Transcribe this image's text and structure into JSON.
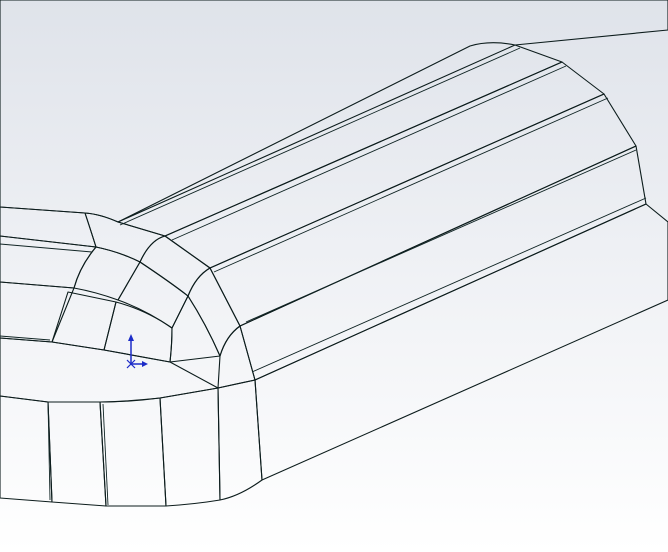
{
  "viewport": {
    "background_top": "#dfe3ea",
    "background_bottom": "#ffffff"
  },
  "model": {
    "kind": "filleted-box-corner",
    "top_face_color": "#79f0ee",
    "fillet_light_color": "#6fe2e0",
    "fillet_mid_color": "#5fc2c0",
    "side_face_color": "#3c7c78",
    "front_face_color": "#7fe7e8",
    "highlight_color": "#ffffff",
    "edge_color": "#0c1c1c"
  },
  "triad": {
    "icon": "coordinate-triad-icon",
    "color": "#1c2cc8"
  }
}
